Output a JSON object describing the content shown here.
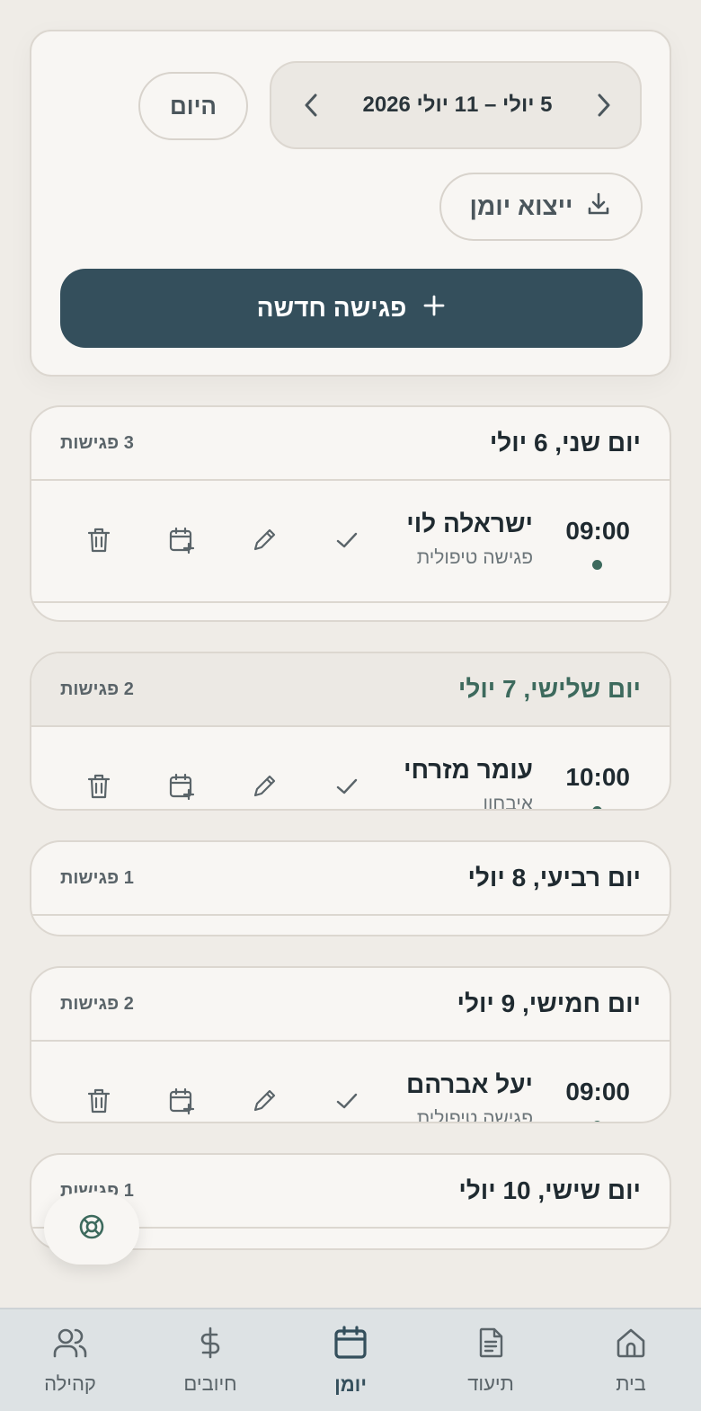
{
  "toolbar": {
    "range_label": "5 יולי – 11 יולי 2026",
    "today_label": "היום",
    "export_label": "ייצוא יומן",
    "new_meeting_label": "פגישה חדשה"
  },
  "days": [
    {
      "title": "יום שני, 6 יולי",
      "count": "3 פגישות",
      "appointments": [
        {
          "time": "09:00",
          "name": "ישראלה לוי",
          "type": "פגישה טיפולית"
        }
      ]
    },
    {
      "title": "יום שלישי, 7 יולי",
      "count": "2 פגישות",
      "appointments": [
        {
          "time": "10:00",
          "name": "עומר מזרחי",
          "type": "איבחון"
        }
      ]
    },
    {
      "title": "יום רביעי, 8 יולי",
      "count": "1 פגישות",
      "appointments": []
    },
    {
      "title": "יום חמישי, 9 יולי",
      "count": "2 פגישות",
      "appointments": [
        {
          "time": "09:00",
          "name": "יעל אברהם",
          "type": "פגישה טיפולית"
        }
      ]
    },
    {
      "title": "יום שישי, 10 יולי",
      "count": "1 פגישות",
      "appointments": []
    }
  ],
  "nav": {
    "home": "בית",
    "docs": "תיעוד",
    "calendar": "יומן",
    "billing": "חיובים",
    "community": "קהילה"
  },
  "colors": {
    "primary": "#344f5c",
    "accent": "#3d6a5d",
    "background": "#efece7",
    "card": "#f8f6f3"
  }
}
